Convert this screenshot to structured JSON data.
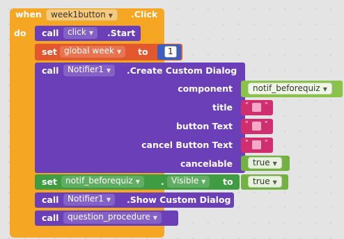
{
  "event": {
    "when": "when",
    "component": "week1button",
    "event_name": ".Click",
    "do": "do"
  },
  "block1": {
    "call": "call",
    "component": "click",
    "method": ".Start"
  },
  "block2": {
    "set": "set",
    "variable": "global week",
    "to": "to",
    "value": "1"
  },
  "block3": {
    "call": "call",
    "component": "Notifier1",
    "method": ".Create Custom Dialog",
    "args": {
      "component": "component",
      "component_value": "notif_beforequiz",
      "title": "title",
      "button_text": "button Text",
      "cancel_button_text": "cancel Button Text",
      "cancelable": "cancelable",
      "cancelable_value": "true"
    }
  },
  "block4": {
    "set": "set",
    "component": "notif_beforequiz",
    "dot": ".",
    "property": "Visible",
    "to": "to",
    "value": "true"
  },
  "block5": {
    "call": "call",
    "component": "Notifier1",
    "method": ".Show Custom Dialog"
  },
  "block6": {
    "call": "call",
    "procedure": "question_procedure"
  },
  "colors": {
    "event": "#f5a623",
    "procedure": "#6a3fb8",
    "variable": "#e2572d",
    "property": "#3f9c43",
    "logic": "#71b241",
    "component": "#8bc34a",
    "text": "#cf2f6e",
    "number": "#3a5fc0"
  }
}
